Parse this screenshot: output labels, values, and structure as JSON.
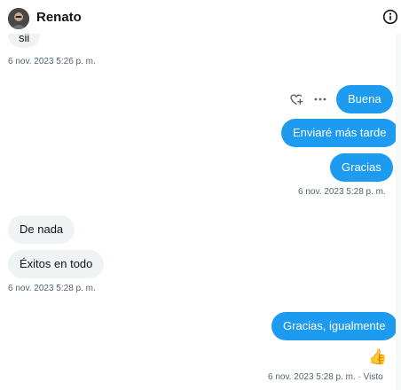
{
  "header": {
    "contact_name": "Renato",
    "avatar_icon": "avatar",
    "info_icon": "info-icon"
  },
  "colors": {
    "accent": "#1d9bf0",
    "incoming_bubble": "#eff3f4",
    "timestamp": "#536471"
  },
  "messages": {
    "partial_incoming": "sii",
    "ts1": "6 nov. 2023 5:26 p. m.",
    "out1": "Buena",
    "out2": "Enviaré más tarde",
    "out3": "Gracias",
    "ts2": "6 nov. 2023 5:28 p. m.",
    "in1": "De nada",
    "in2": "Éxitos en todo",
    "ts3": "6 nov. 2023 5:28 p. m.",
    "out4": "Gracias, igualmente",
    "reaction": "👍",
    "ts4": "6 nov. 2023 5:28 p. m. · Visto"
  },
  "message_actions": {
    "react_icon": "heart-plus-icon",
    "more_icon": "more-icon"
  }
}
